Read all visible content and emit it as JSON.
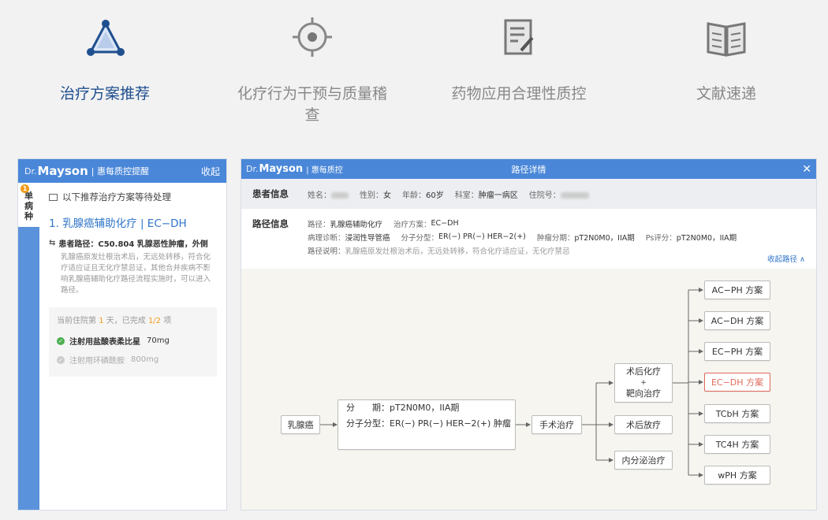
{
  "tabs": [
    {
      "label": "治疗方案推荐",
      "icon": "triangle-network-icon",
      "active": true
    },
    {
      "label": "化疗行为干预与质量稽查",
      "icon": "target-icon",
      "active": false
    },
    {
      "label": "药物应用合理性质控",
      "icon": "document-edit-icon",
      "active": false
    },
    {
      "label": "文献速递",
      "icon": "open-book-icon",
      "active": false
    }
  ],
  "left_panel": {
    "brand_prefix": "Dr.",
    "brand_name": "Mayson",
    "subtitle": "| 惠每质控提醒",
    "close_label": "收起",
    "side_tab": "单病种",
    "side_badge": "1",
    "notice": "以下推荐治疗方案等待处理",
    "item_title": "1. 乳腺癌辅助化疗 | EC−DH",
    "path_text": "患者路径：C50.804 乳腺恶性肿瘤，外侧",
    "path_desc": "乳腺癌原发灶根治术后，无远处转移，符合化疗适应证且无化疗禁忌证，其他合并疾病不影响乳腺癌辅助化疗路径流程实施时，可以进入路径。",
    "progress_prefix": "当前住院第",
    "progress_day": "1",
    "progress_mid": "天，已完成",
    "progress_done": "1/2",
    "progress_suffix": "项",
    "drugs": [
      {
        "name": "注射用盐酸表柔比星",
        "dose": "70mg",
        "done": true
      },
      {
        "name": "注射用环磷酰胺",
        "dose": "800mg",
        "done": false
      }
    ]
  },
  "right_panel": {
    "brand_prefix": "Dr.",
    "brand_name": "Mayson",
    "subtitle": "| 惠每质控",
    "title": "路径详情",
    "close_icon": "close-icon",
    "patient_section": "患者信息",
    "patient": {
      "name_label": "姓名：",
      "gender_label": "性别：",
      "gender": "女",
      "age_label": "年龄：",
      "age": "60岁",
      "dept_label": "科室：",
      "dept": "肿瘤一病区",
      "inpatient_label": "住院号："
    },
    "path_section": "路径信息",
    "path_info": {
      "path_label": "路径：",
      "path": "乳腺癌辅助化疗",
      "plan_label": "治疗方案：",
      "plan": "EC−DH",
      "diag_label": "病理诊断：",
      "diag": "浸润性导管癌",
      "mol_label": "分子分型：",
      "mol": "ER(−) PR(−) HER−2(+)",
      "stage_label": "肿瘤分期：",
      "stage": "pT2N0M0，IIA期",
      "ps_label": "Ps评分：",
      "ps": "pT2N0M0，IIA期",
      "desc_label": "路径说明：",
      "desc": "乳腺癌原发灶根治术后，无远处转移，符合化疗适应证，无化疗禁忌"
    },
    "collapse_label": "收起路径 ∧",
    "flow": {
      "root": "乳腺癌",
      "info_line1": "分　　期：pT2N0M0，IIA期",
      "info_line2": "分子分型：ER(−) PR(−) HER−2(+)  肿瘤",
      "surgery": "手术治疗",
      "chemo_line1": "术后化疗",
      "chemo_line2": "+",
      "chemo_line3": "靶向治疗",
      "radio": "术后放疗",
      "endocrine": "内分泌治疗",
      "plans": [
        "AC−PH 方案",
        "AC−DH 方案",
        "EC−PH 方案",
        "EC−DH 方案",
        "TCbH 方案",
        "TC4H 方案",
        "wPH 方案"
      ],
      "highlight_plan": "EC−DH 方案"
    }
  }
}
